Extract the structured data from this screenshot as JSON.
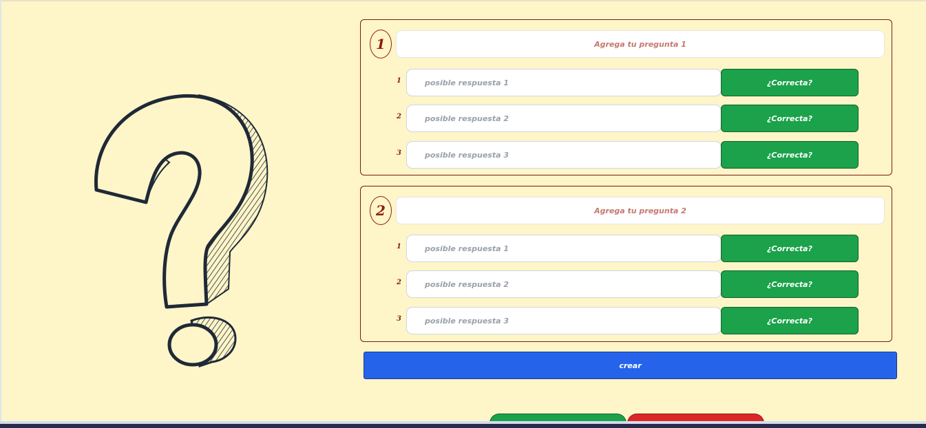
{
  "questions": [
    {
      "number": "1",
      "placeholder": "Agrega tu pregunta 1",
      "answers": [
        {
          "number": "1",
          "placeholder": "posible respuesta 1",
          "button": "¿Correcta?"
        },
        {
          "number": "2",
          "placeholder": "posible respuesta 2",
          "button": "¿Correcta?"
        },
        {
          "number": "3",
          "placeholder": "posible respuesta 3",
          "button": "¿Correcta?"
        }
      ]
    },
    {
      "number": "2",
      "placeholder": "Agrega tu pregunta 2",
      "answers": [
        {
          "number": "1",
          "placeholder": "posible respuesta 1",
          "button": "¿Correcta?"
        },
        {
          "number": "2",
          "placeholder": "posible respuesta 2",
          "button": "¿Correcta?"
        },
        {
          "number": "3",
          "placeholder": "posible respuesta 3",
          "button": "¿Correcta?"
        }
      ]
    }
  ],
  "create_button": "crear",
  "icons": {
    "illustration": "question-mark-illustration"
  },
  "colors": {
    "background": "#fef5c8",
    "accent_dark_red": "#8b1e14",
    "correct_green": "#1ba24a",
    "create_blue": "#2563eb",
    "cancel_red": "#dc2626"
  }
}
